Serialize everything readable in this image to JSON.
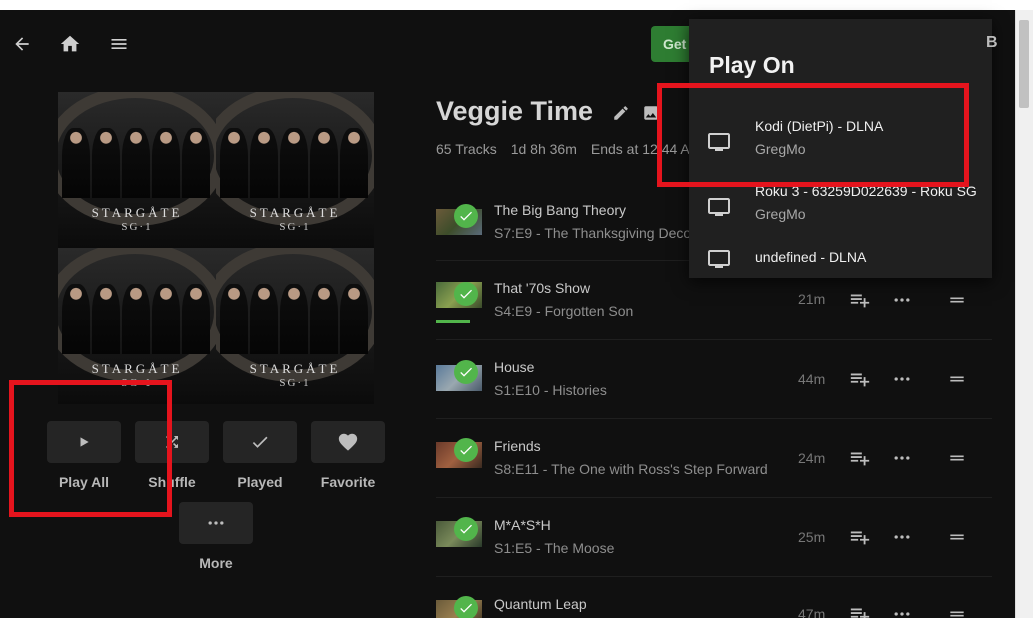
{
  "header": {
    "back_icon": "arrow-left-icon",
    "home_icon": "home-icon",
    "menu_icon": "hamburger-icon",
    "get_button_label": "Get"
  },
  "playlist": {
    "title": "Veggie Time",
    "track_count": "65 Tracks",
    "duration": "1d 8h 36m",
    "ends_at": "Ends at 12:44 A",
    "artwork_logo": "STARGÅTE",
    "artwork_sub": "SG·1"
  },
  "actions": {
    "play_all": "Play All",
    "shuffle": "Shuffle",
    "played": "Played",
    "favorite": "Favorite",
    "more": "More"
  },
  "tracks": [
    {
      "name": "The Big Bang Theory",
      "sub": "S7:E9 - The Thanksgiving Deco",
      "duration": "",
      "played": true
    },
    {
      "name": "That '70s Show",
      "sub": "S4:E9 - Forgotten Son",
      "duration": "21m",
      "played": true
    },
    {
      "name": "House",
      "sub": "S1:E10 - Histories",
      "duration": "44m",
      "played": true
    },
    {
      "name": "Friends",
      "sub": "S8:E11 - The One with Ross's Step Forward",
      "duration": "24m",
      "played": true
    },
    {
      "name": "M*A*S*H",
      "sub": "S1:E5 - The Moose",
      "duration": "25m",
      "played": true
    },
    {
      "name": "Quantum Leap",
      "sub": "",
      "duration": "47m",
      "played": true
    }
  ],
  "play_on_menu": {
    "title": "Play On",
    "devices": [
      {
        "name": "Kodi (DietPi) - DLNA",
        "user": "GregMo"
      },
      {
        "name": "Roku 3 - 63259D022639 - Roku SG",
        "user": "GregMo"
      },
      {
        "name": "undefined - DLNA",
        "user": ""
      }
    ]
  },
  "colors": {
    "accent_green": "#52b54b",
    "highlight_red": "#e5141d",
    "background": "#101010"
  }
}
